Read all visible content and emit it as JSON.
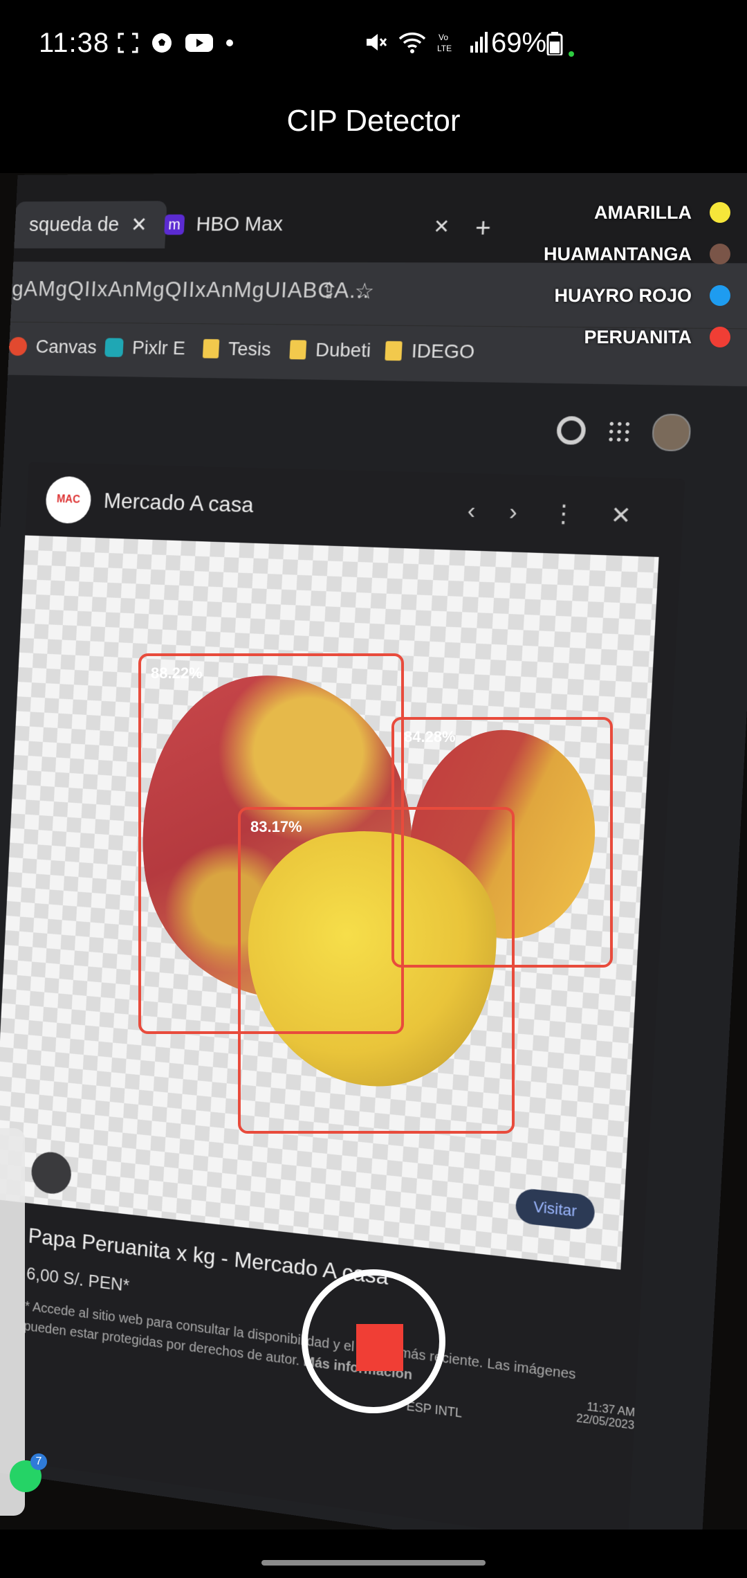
{
  "status_bar": {
    "time": "11:38",
    "battery": "69%",
    "left_icons": [
      "screenshot-icon",
      "soccer-ball-icon",
      "youtube-icon",
      "dot-icon"
    ],
    "right_icons": [
      "mute-icon",
      "wifi-icon",
      "volte-icon",
      "signal-icon",
      "battery-icon"
    ]
  },
  "app_bar": {
    "title": "CIP Detector"
  },
  "legend": [
    {
      "label": "AMARILLA",
      "color": "#f6e63a"
    },
    {
      "label": "HUAMANTANGA",
      "color": "#7a5548"
    },
    {
      "label": "HUAYRO ROJO",
      "color": "#1e9cf0"
    },
    {
      "label": "PERUANITA",
      "color": "#f03e35"
    }
  ],
  "detections": [
    {
      "label": "88.22%",
      "class": "PERUANITA"
    },
    {
      "label": "84.28%",
      "class": "PERUANITA"
    },
    {
      "label": "83.17%",
      "class": "PERUANITA"
    }
  ],
  "camera_feed": {
    "browser_tab_active": "squeda de",
    "browser_tab_2": "HBO Max",
    "url": "gAMgQIIxAnMgQIIxAnMgUIABCA...",
    "bookmarks": [
      "Canvas",
      "Pixlr E",
      "Tesis",
      "Dubeti",
      "IDEGO"
    ],
    "panel_title": "Mercado A casa",
    "mac_logo": "MAC",
    "visit_button": "Visitar",
    "product_title": "Papa Peruanita x kg - Mercado A casa",
    "product_price": "6,00 S/. PEN*",
    "product_note": "* Accede al sitio web para consultar la disponibilidad y el precio más reciente. Las imágenes pueden estar protegidas por derechos de autor.",
    "product_note_link": "Más información",
    "taskbar_lang": "ESP INTL",
    "taskbar_clock": "11:37 AM 22/05/2023"
  },
  "controls": {
    "record_state": "recording"
  }
}
